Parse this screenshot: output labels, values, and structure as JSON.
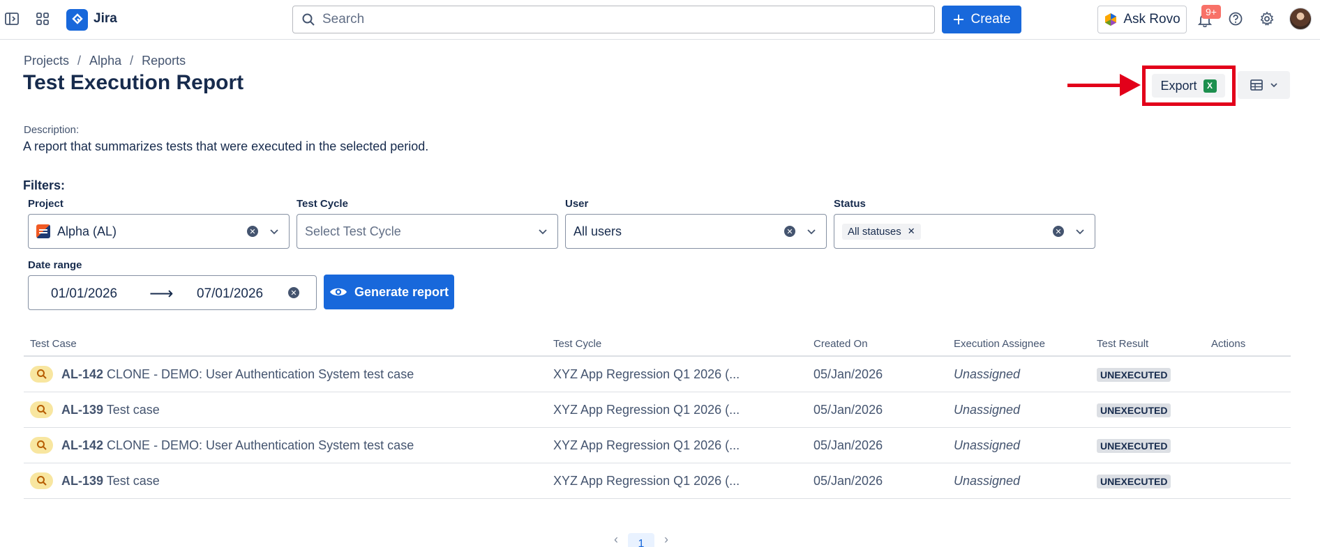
{
  "nav": {
    "app_name": "Jira",
    "search_placeholder": "Search",
    "create_label": "Create",
    "rovo_label": "Ask Rovo",
    "notification_badge": "9+",
    "icons": [
      "sidebar-toggle-icon",
      "app-switcher-icon",
      "jira-logo-icon",
      "search-icon",
      "plus-icon",
      "rovo-icon",
      "bell-icon",
      "help-icon",
      "gear-icon"
    ]
  },
  "breadcrumb": [
    "Projects",
    "Alpha",
    "Reports"
  ],
  "page_title": "Test Execution Report",
  "actions": {
    "export_label": "Export",
    "excel_glyph": "X"
  },
  "description": {
    "label": "Description:",
    "text": "A report that summarizes tests that were executed in the selected period."
  },
  "filters": {
    "label": "Filters:",
    "project": {
      "label": "Project",
      "value": "Alpha (AL)"
    },
    "test_cycle": {
      "label": "Test Cycle",
      "placeholder": "Select Test Cycle"
    },
    "user": {
      "label": "User",
      "value": "All users"
    },
    "status": {
      "label": "Status",
      "tag": "All statuses"
    },
    "date_range": {
      "label": "Date range",
      "start": "01/01/2026",
      "end": "07/01/2026"
    },
    "generate_label": "Generate report"
  },
  "table": {
    "columns": [
      "Test Case",
      "Test Cycle",
      "Created On",
      "Execution Assignee",
      "Test Result",
      "Actions"
    ],
    "rows": [
      {
        "key": "AL-142",
        "summary": "CLONE - DEMO: User Authentication System test case",
        "cycle": "XYZ App Regression Q1 2026 (...",
        "created": "05/Jan/2026",
        "assignee": "Unassigned",
        "result": "UNEXECUTED"
      },
      {
        "key": "AL-139",
        "summary": "Test case",
        "cycle": "XYZ App Regression Q1 2026 (...",
        "created": "05/Jan/2026",
        "assignee": "Unassigned",
        "result": "UNEXECUTED"
      },
      {
        "key": "AL-142",
        "summary": "CLONE - DEMO: User Authentication System test case",
        "cycle": "XYZ App Regression Q1 2026 (...",
        "created": "05/Jan/2026",
        "assignee": "Unassigned",
        "result": "UNEXECUTED"
      },
      {
        "key": "AL-139",
        "summary": "Test case",
        "cycle": "XYZ App Regression Q1 2026 (...",
        "created": "05/Jan/2026",
        "assignee": "Unassigned",
        "result": "UNEXECUTED"
      }
    ]
  },
  "pagination": {
    "current_page": "1"
  },
  "colors": {
    "brand_blue": "#1868db",
    "annotation_red": "#e2001a",
    "excel_green": "#1d8f4e",
    "test_case_icon_bg": "#f8e6a0"
  }
}
